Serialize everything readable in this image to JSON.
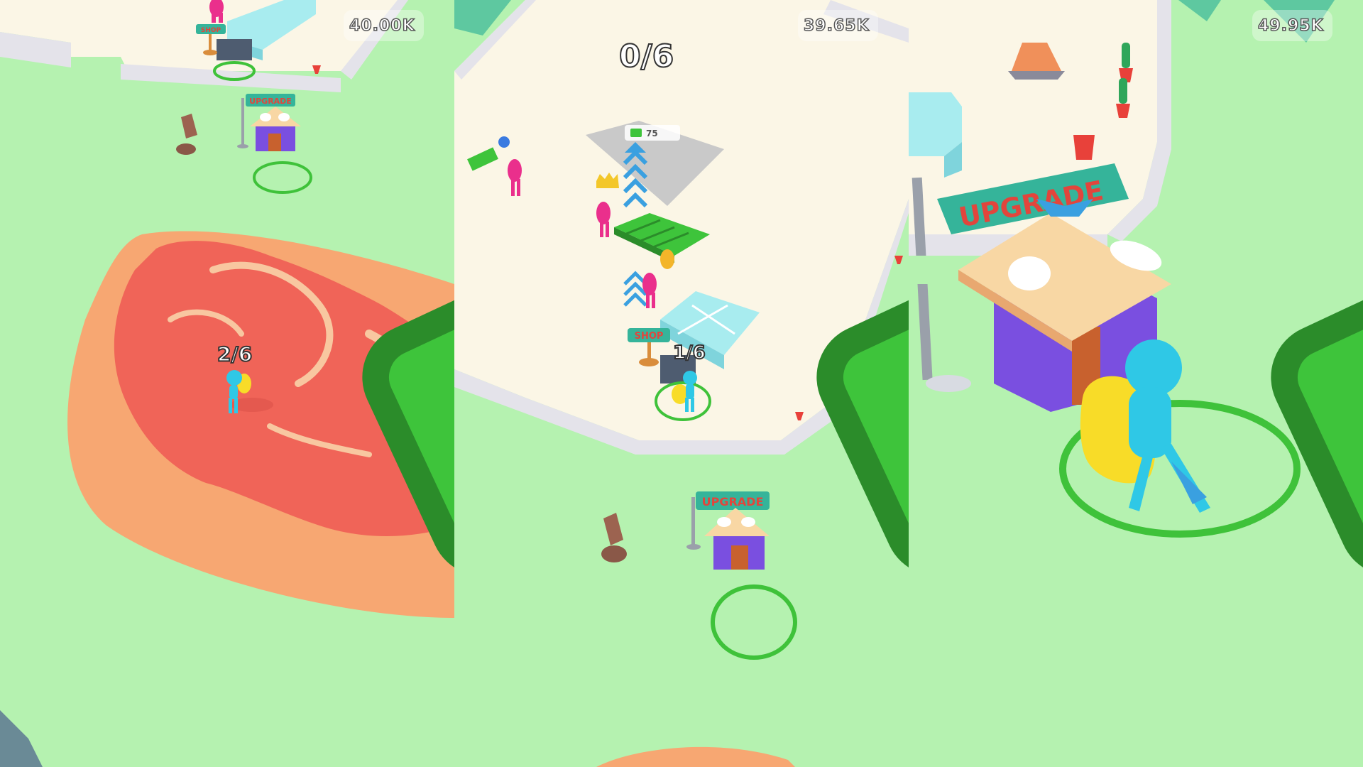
{
  "game": {
    "panels": [
      {
        "money": "40.00K",
        "carry_counter": "2/6",
        "upgrade_sign": "UPGRADE",
        "shop_sign": "SHOP"
      },
      {
        "money": "39.65K",
        "goal_counter": "0/6",
        "carry_counter": "1/6",
        "price_tag": "75",
        "upgrade_sign": "UPGRADE",
        "shop_sign": "SHOP"
      },
      {
        "money": "49.95K",
        "upgrade_sign": "UPGRADE"
      }
    ]
  },
  "colors": {
    "grass": "#b5f2b0",
    "floor": "#fbf6e6",
    "wall": "#e4e3ea",
    "slime_base": "#f7a772",
    "slime_red": "#f06458",
    "ring": "#3fc23a",
    "player": "#2fc8e6",
    "backpack": "#f8dc28",
    "npc": "#ea2f8c",
    "cash": "#3ec43b",
    "house_roof": "#f8d7a4",
    "house_wall": "#7a4fe0",
    "house_door": "#c8612e",
    "sign_board": "#35b49a",
    "tile": "#a8ecef"
  },
  "icons": [
    "cash-icon",
    "shovel-icon",
    "crown-icon",
    "arrow-up-icon"
  ]
}
